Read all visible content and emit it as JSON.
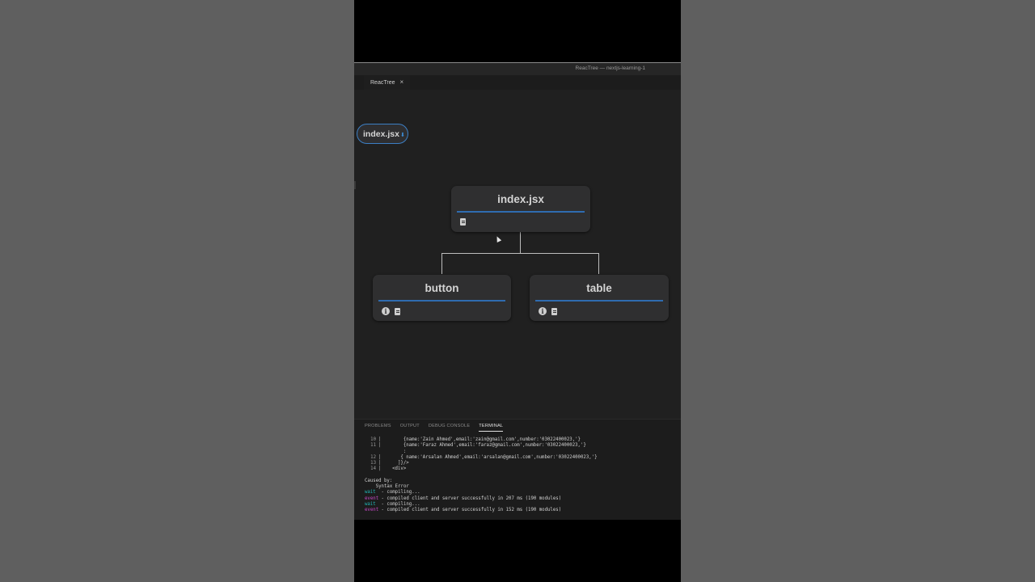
{
  "window": {
    "title": "ReacTree — nextjs-learning-1"
  },
  "tab": {
    "label": "ReacTree",
    "close": "×"
  },
  "root_pill": {
    "label": "index.jsx"
  },
  "tree": {
    "root": {
      "label": "index.jsx"
    },
    "children": [
      {
        "label": "button"
      },
      {
        "label": "table"
      }
    ]
  },
  "panel": {
    "tabs": [
      "PROBLEMS",
      "OUTPUT",
      "DEBUG CONSOLE",
      "TERMINAL"
    ],
    "active_tab": "TERMINAL"
  },
  "terminal": {
    "code_lines": [
      {
        "num": "10",
        "text": "        {name:'Zain Ahmed',email:'zain@gmail.com',number:'03022400023,'}"
      },
      {
        "num": "11",
        "text": "        {name:'Faraz Ahmed',email:'faraz@gmail.com',number:'03022400023,'}"
      },
      {
        "num": "",
        "text": "        :"
      },
      {
        "num": "12",
        "text": "       { name:'Arsalan Ahmed',email:'arsalan@gmail.com',number:'03022400023,'}"
      },
      {
        "num": "13",
        "text": "      ]}/>"
      },
      {
        "num": "14",
        "text": "    <div>"
      }
    ],
    "caused_by": "Caused by:",
    "error": "    Syntax Error",
    "logs": [
      {
        "kind": "wait",
        "text": "  - compiling..."
      },
      {
        "kind": "event",
        "text": " - compiled client and server successfully in 207 ms (190 modules)"
      },
      {
        "kind": "wait",
        "text": "  - compiling..."
      },
      {
        "kind": "event",
        "text": " - compiled client and server successfully in 152 ms (190 modules)"
      }
    ]
  },
  "colors": {
    "accent_blue": "#2f6cb0",
    "wait": "#21b3b3",
    "event": "#c447c4"
  }
}
